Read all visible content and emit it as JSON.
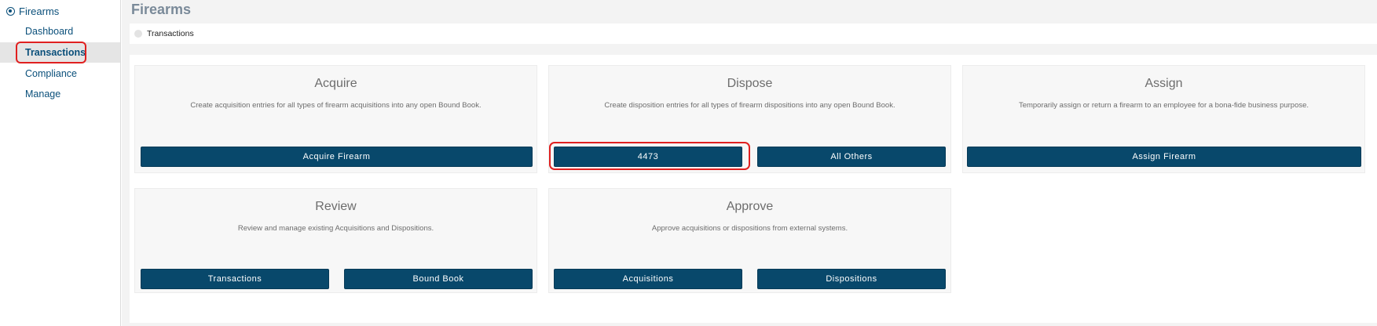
{
  "sidebar": {
    "header": "Firearms",
    "items": [
      {
        "label": "Dashboard"
      },
      {
        "label": "Transactions"
      },
      {
        "label": "Compliance"
      },
      {
        "label": "Manage"
      }
    ]
  },
  "main": {
    "title": "Firearms",
    "breadcrumb": "Transactions"
  },
  "cards": {
    "acquire": {
      "title": "Acquire",
      "desc": "Create acquisition entries for all types of firearm acquisitions into any open Bound Book.",
      "btn1": "Acquire Firearm"
    },
    "dispose": {
      "title": "Dispose",
      "desc": "Create disposition entries for all types of firearm dispositions into any open Bound Book.",
      "btn1": "4473",
      "btn2": "All Others"
    },
    "assign": {
      "title": "Assign",
      "desc": "Temporarily assign or return a firearm to an employee for a bona-fide business purpose.",
      "btn1": "Assign Firearm"
    },
    "review": {
      "title": "Review",
      "desc": "Review and manage existing Acquisitions and Dispositions.",
      "btn1": "Transactions",
      "btn2": "Bound Book"
    },
    "approve": {
      "title": "Approve",
      "desc": "Approve acquisitions or dispositions from external systems.",
      "btn1": "Acquisitions",
      "btn2": "Dispositions"
    }
  },
  "colors": {
    "button_bg": "#08486b",
    "nav_text": "#0a4f7a",
    "highlight": "#e02020"
  }
}
